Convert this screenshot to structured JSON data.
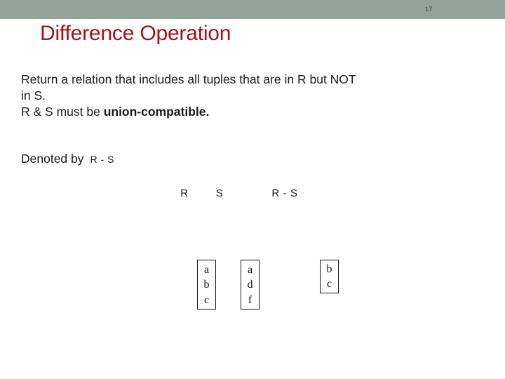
{
  "header": {
    "slide_number": "17",
    "bar_color": "#93a49b"
  },
  "title": {
    "text": "Difference Operation",
    "color": "#a81118"
  },
  "body": {
    "line1": "Return a relation that includes all tuples that are in R but NOT",
    "line2": "in S.",
    "line3_prefix": "R & S must be ",
    "line3_bold": "union-compatible.",
    "denoted_label": "Denoted by",
    "denoted_expression": "R - S"
  },
  "diagram": {
    "labels": {
      "r": "R",
      "s": "S",
      "result": "R - S"
    },
    "sets": [
      {
        "name": "R",
        "elements": [
          "a",
          "b",
          "c"
        ]
      },
      {
        "name": "S",
        "elements": [
          "a",
          "d",
          "f"
        ]
      },
      {
        "name": "R - S",
        "elements": [
          "b",
          "c"
        ]
      }
    ]
  }
}
